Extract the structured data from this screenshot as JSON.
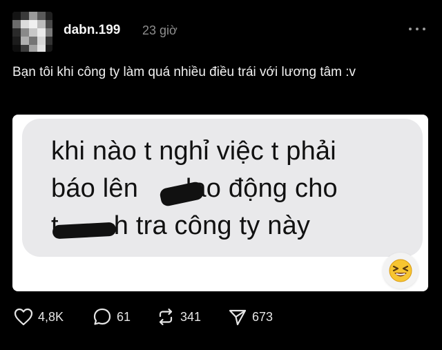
{
  "post": {
    "username": "dabn.199",
    "time": "23 giờ",
    "caption": "Bạn tôi khi công ty làm quá nhiều điều trái với lương tâm :v"
  },
  "image": {
    "lines": [
      "khi nào t nghỉ việc t phải",
      "báo lên ",
      "lao động cho",
      "h tra công ty này"
    ],
    "line3_prefix": "t",
    "reaction_emoji": "😆"
  },
  "actions": {
    "likes": "4,8K",
    "comments": "61",
    "reposts": "341",
    "shares": "673"
  },
  "icons": {
    "like": "heart-icon",
    "comment": "comment-icon",
    "repost": "repost-icon",
    "share": "share-icon",
    "more": "more-icon"
  }
}
